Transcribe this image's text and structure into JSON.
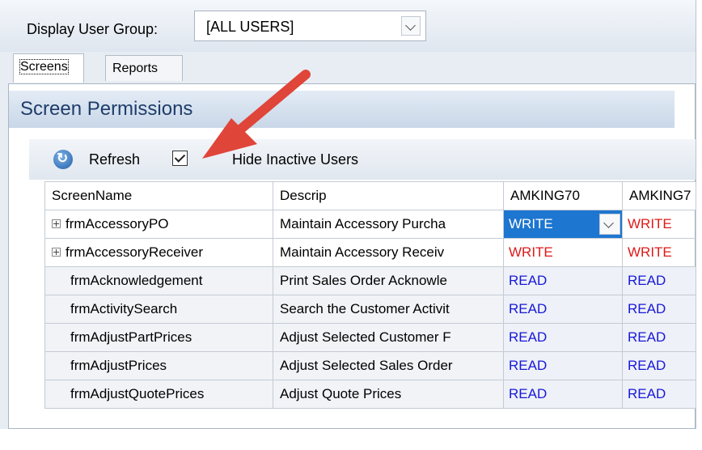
{
  "header": {
    "group_label": "Display User Group:",
    "group_value": "[ALL USERS]"
  },
  "tabs": [
    {
      "label": "Screens",
      "active": true
    },
    {
      "label": "Reports",
      "active": false
    }
  ],
  "panel": {
    "title": "Screen Permissions"
  },
  "toolbar": {
    "refresh_label": "Refresh",
    "hide_inactive_checked": true,
    "hide_inactive_label": "Hide Inactive Users",
    "refresh_icon": "refresh-icon"
  },
  "grid": {
    "columns": [
      "ScreenName",
      "Descrip",
      "AMKING70",
      "AMKING7"
    ],
    "rows": [
      {
        "expandable": true,
        "name": "frmAccessoryPO",
        "descrip": "Maintain Accessory Purcha",
        "perm1": "WRITE",
        "perm2": "WRITE"
      },
      {
        "expandable": true,
        "name": "frmAccessoryReceiver",
        "descrip": "Maintain Accessory Receiv",
        "perm1": "WRITE",
        "perm2": "WRITE"
      },
      {
        "expandable": false,
        "name": "frmAcknowledgement",
        "descrip": "Print Sales Order Acknowle",
        "perm1": "READ",
        "perm2": "READ"
      },
      {
        "expandable": false,
        "name": "frmActivitySearch",
        "descrip": "Search the Customer Activit",
        "perm1": "READ",
        "perm2": "READ"
      },
      {
        "expandable": false,
        "name": "frmAdjustPartPrices",
        "descrip": "Adjust Selected Customer F",
        "perm1": "READ",
        "perm2": "READ"
      },
      {
        "expandable": false,
        "name": "frmAdjustPrices",
        "descrip": "Adjust Selected Sales Order",
        "perm1": "READ",
        "perm2": "READ"
      },
      {
        "expandable": false,
        "name": "frmAdjustQuotePrices",
        "descrip": "Adjust Quote Prices",
        "perm1": "READ",
        "perm2": "READ"
      }
    ]
  },
  "colors": {
    "read": "#1818d8",
    "write": "#e01818",
    "selected": "#1d76d0",
    "arrow": "#e0453a"
  }
}
